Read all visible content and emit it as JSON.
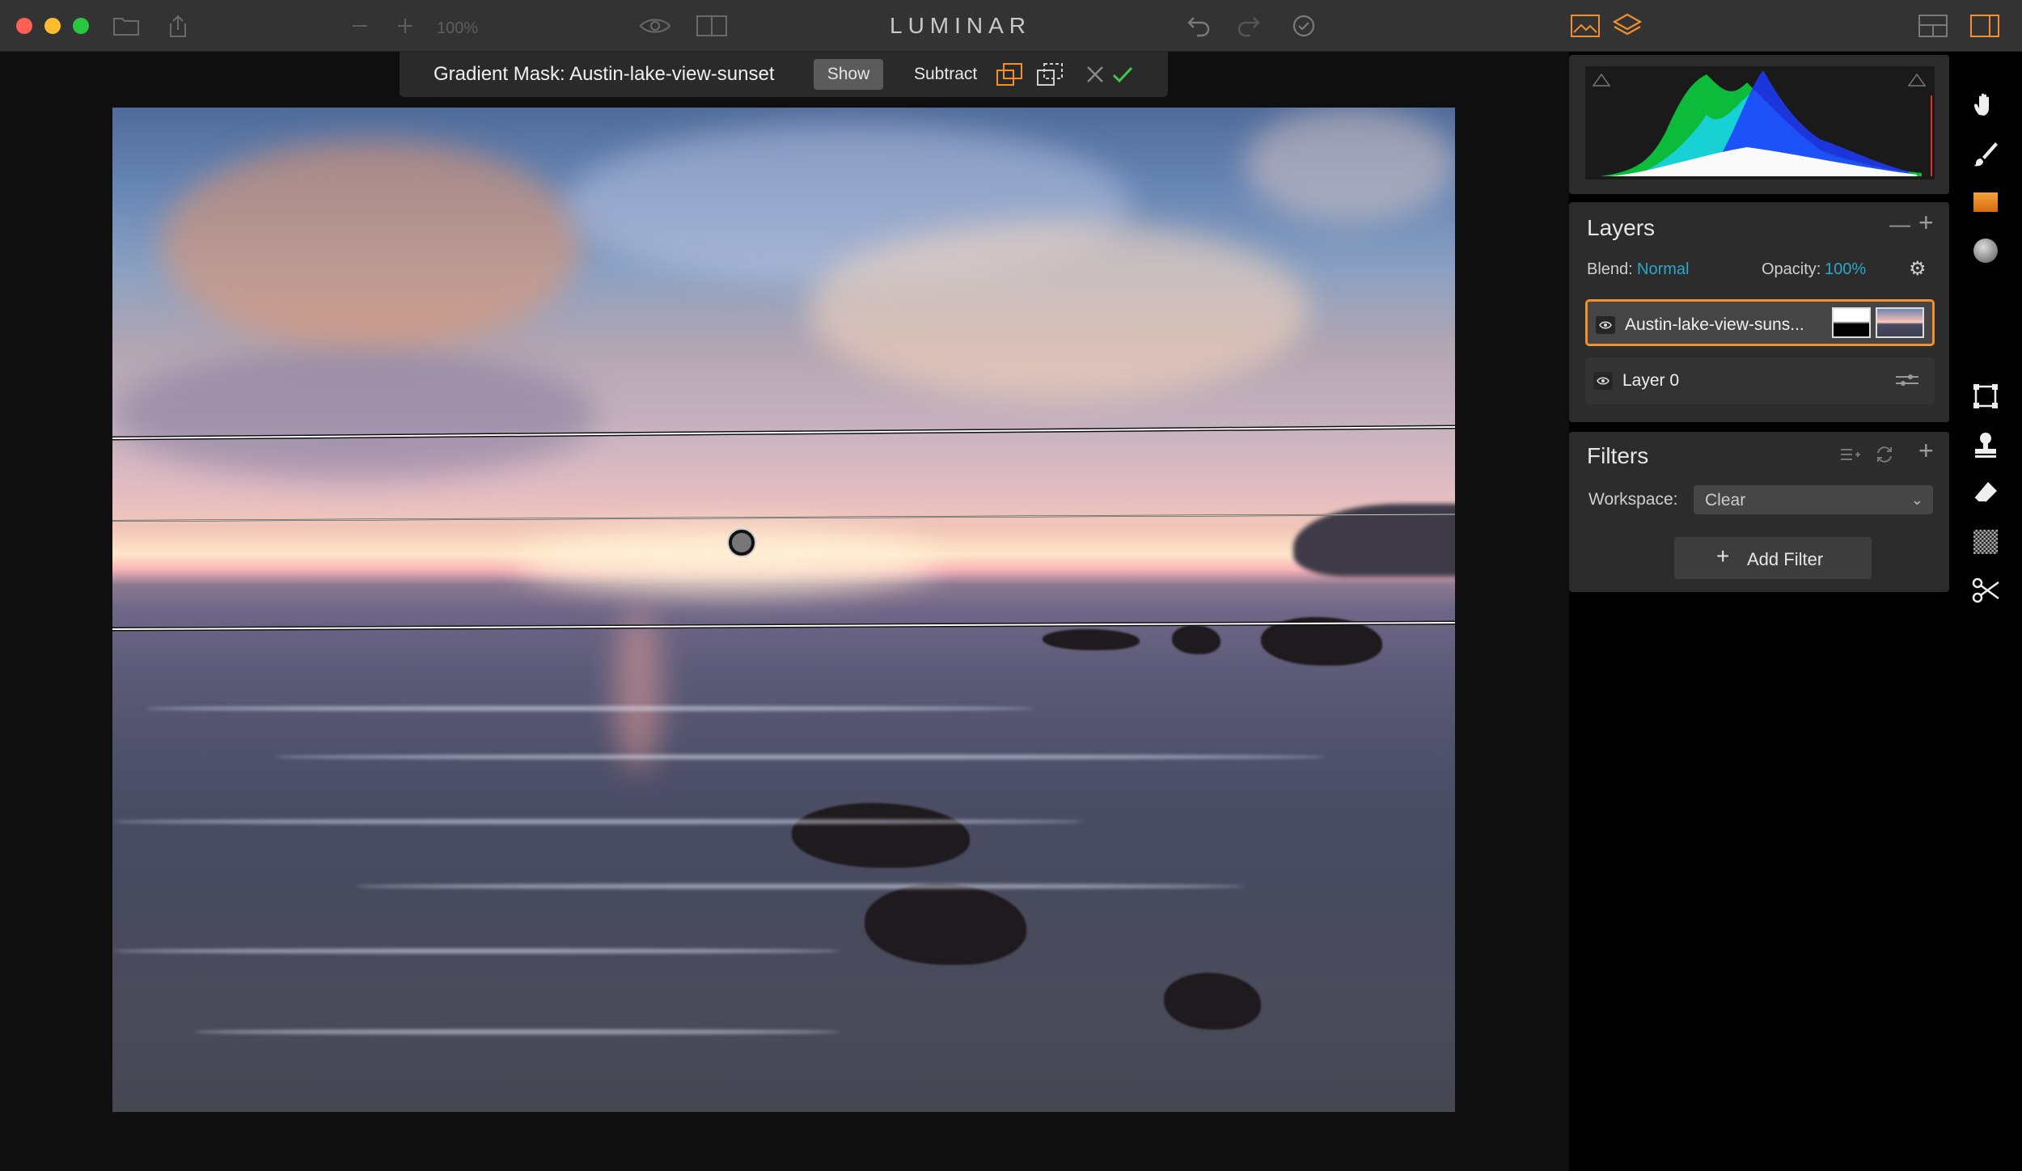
{
  "app": {
    "brand": "LUMINAR",
    "zoom": "100%"
  },
  "mask_bar": {
    "title": "Gradient Mask: Austin-lake-view-sunset",
    "show_label": "Show",
    "subtract_label": "Subtract"
  },
  "layers": {
    "title": "Layers",
    "blend_label": "Blend:",
    "blend_value": "Normal",
    "opacity_label": "Opacity:",
    "opacity_value": "100%",
    "items": [
      {
        "name": "Austin-lake-view-suns..."
      },
      {
        "name": "Layer 0"
      }
    ]
  },
  "filters": {
    "title": "Filters",
    "workspace_label": "Workspace:",
    "workspace_value": "Clear",
    "add_filter_label": "Add Filter"
  },
  "colors": {
    "accent_orange": "#f0902e",
    "accent_blue": "#2aa7c9",
    "confirm_green": "#3fc84a"
  }
}
